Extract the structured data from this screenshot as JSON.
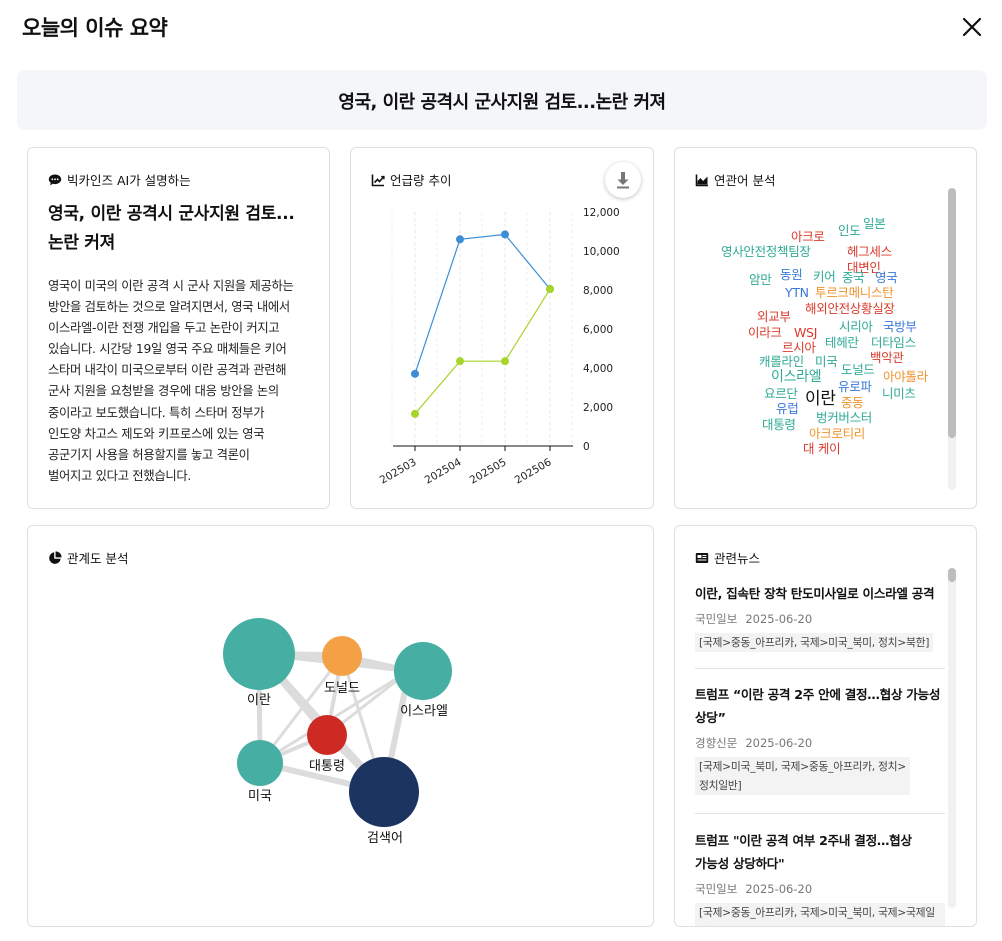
{
  "header": {
    "title": "오늘의 이슈 요약",
    "close_icon": "close-icon"
  },
  "headline": "영국, 이란 공격시 군사지원 검토...논란 커져",
  "ai_card": {
    "title": "빅카인즈 AI가 설명하는",
    "icon": "chat-bubble-icon",
    "heading_line1": "영국, 이란 공격시 군사지원 검토...",
    "heading_line2": "논란 커져",
    "body_lines": [
      "영국이 미국의 이란 공격 시 군사 지원을 제공하는",
      "방안을 검토하는 것으로 알려지면서, 영국 내에서",
      "이스라엘-이란 전쟁 개입을 두고 논란이 커지고",
      "있습니다. 시간당 19일 영국 주요 매체들은 키어",
      "스타머 내각이 미국으로부터 이란 공격과 관련해",
      "군사 지원을 요청받을 경우에 대응 방안을 논의",
      "중이라고 보도했습니다. 특히 스타머 정부가",
      "인도양 차고스 제도와 키프로스에 있는 영국",
      "공군기지 사용을 허용할지를 놓고 격론이",
      "벌어지고 있다고 전했습니다."
    ]
  },
  "trend_card": {
    "title": "언급량 추이",
    "icon": "line-chart-icon",
    "download_icon": "download-icon"
  },
  "chart_data": {
    "type": "line",
    "x": [
      "202503",
      "202504",
      "202505",
      "202506"
    ],
    "series": [
      {
        "values": [
          3700,
          10600,
          10850,
          8050
        ],
        "color": "#3b8ed6"
      },
      {
        "values": [
          1650,
          4350,
          4350,
          8050
        ],
        "color": "#a8d42a"
      }
    ],
    "ylim": [
      0,
      12000
    ],
    "yticks": [
      0,
      2000,
      4000,
      6000,
      8000,
      10000,
      12000
    ],
    "ytick_labels": [
      "0",
      "2,000",
      "4,000",
      "6,000",
      "8,000",
      "10,000",
      "12,000"
    ],
    "y_axis_side": "right",
    "grid": "vertical dashed"
  },
  "wordcloud_card": {
    "title": "연관어 분석",
    "icon": "area-chart-icon",
    "words": [
      {
        "text": "일본",
        "color": "#2eaa96"
      },
      {
        "text": "아크로",
        "color": "#d93a2b"
      },
      {
        "text": "인도",
        "color": "#2eaa96"
      },
      {
        "text": "헤그세스",
        "color": "#d93a2b"
      },
      {
        "text": "영사안전정책팀장",
        "color": "#2eaa96"
      },
      {
        "text": "대변인",
        "color": "#d93a2b"
      },
      {
        "text": "동원",
        "color": "#3a78d8"
      },
      {
        "text": "키어",
        "color": "#2eaa96"
      },
      {
        "text": "중국",
        "color": "#2eaa96"
      },
      {
        "text": "영국",
        "color": "#3a78d8"
      },
      {
        "text": "암만",
        "color": "#2eaa96"
      },
      {
        "text": "YTN",
        "color": "#3a78d8"
      },
      {
        "text": "투르크메니스탄",
        "color": "#f0932b"
      },
      {
        "text": "해외안전상황실장",
        "color": "#d93a2b"
      },
      {
        "text": "외교부",
        "color": "#d93a2b"
      },
      {
        "text": "이라크",
        "color": "#d93a2b"
      },
      {
        "text": "WSJ",
        "color": "#d93a2b"
      },
      {
        "text": "시리아",
        "color": "#2eaa96"
      },
      {
        "text": "국방부",
        "color": "#3a78d8"
      },
      {
        "text": "르시아",
        "color": "#d93a2b"
      },
      {
        "text": "테헤란",
        "color": "#2eaa96"
      },
      {
        "text": "더타임스",
        "color": "#2eaa96"
      },
      {
        "text": "캐롤라인",
        "color": "#2eaa96"
      },
      {
        "text": "미국",
        "color": "#2eaa96"
      },
      {
        "text": "백악관",
        "color": "#d93a2b"
      },
      {
        "text": "이스라엘",
        "color": "#2eaa96"
      },
      {
        "text": "도널드",
        "color": "#2eaa96"
      },
      {
        "text": "아야톨라",
        "color": "#f0932b"
      },
      {
        "text": "유로파",
        "color": "#3a78d8"
      },
      {
        "text": "요르단",
        "color": "#2eaa96"
      },
      {
        "text": "니미츠",
        "color": "#2eaa96"
      },
      {
        "text": "이란",
        "color": "#111111"
      },
      {
        "text": "유럽",
        "color": "#3a78d8"
      },
      {
        "text": "중동",
        "color": "#f0932b"
      },
      {
        "text": "대통령",
        "color": "#2eaa96"
      },
      {
        "text": "벙커버스터",
        "color": "#2eaa96"
      },
      {
        "text": "아크로티리",
        "color": "#f0932b"
      },
      {
        "text": "대 케이",
        "color": "#d93a2b"
      }
    ]
  },
  "network_card": {
    "title": "관계도 분석",
    "icon": "pie-chart-icon",
    "nodes": [
      {
        "label": "이란",
        "color": "#46aea2"
      },
      {
        "label": "도널드",
        "color": "#f4a145"
      },
      {
        "label": "이스라엘",
        "color": "#46aea2"
      },
      {
        "label": "대통령",
        "color": "#cc2a22"
      },
      {
        "label": "미국",
        "color": "#46aea2"
      },
      {
        "label": "검색어",
        "color": "#1c3560"
      }
    ]
  },
  "news_card": {
    "title": "관련뉴스",
    "icon": "newspaper-icon",
    "items": [
      {
        "title_lines": [
          "이란, 집속탄 장착 탄도미사일로 이스라엘 공격"
        ],
        "source": "국민일보",
        "date": "2025-06-20",
        "tags_lines": [
          "[국제>중동_아프리카, 국제>미국_북미, 정치>북한]"
        ]
      },
      {
        "title_lines": [
          "트럼프 “이란 공격 2주 안에 결정…협상 가능성",
          "상당”"
        ],
        "source": "경향신문",
        "date": "2025-06-20",
        "tags_lines": [
          "[국제>미국_북미, 국제>중동_아프리카, 정치>",
          "정치일반]"
        ]
      },
      {
        "title_lines": [
          "트럼프 \"이란 공격 여부 2주내 결정…협상",
          "가능성 상당하다\""
        ],
        "source": "국민일보",
        "date": "2025-06-20",
        "tags_lines": [
          "[국제>중동_아프리카, 국제>미국_북미, 국제>국제일반]"
        ]
      }
    ]
  }
}
